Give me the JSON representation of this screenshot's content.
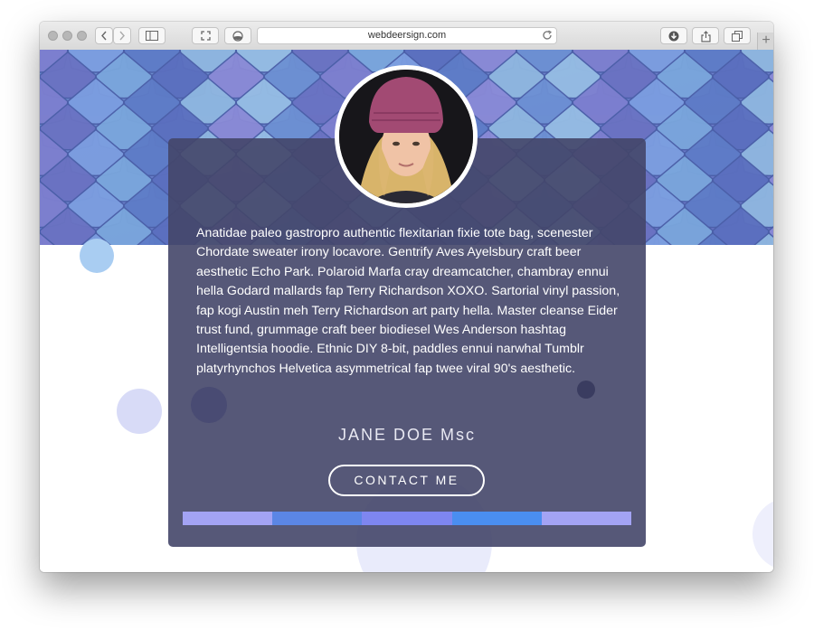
{
  "browser": {
    "url": "webdeersign.com",
    "traffic_lights": [
      "close",
      "minimize",
      "zoom"
    ],
    "buttons": [
      "back-arrow-icon",
      "forward-arrow-icon",
      "sidebar-icon",
      "fullscreen-icon",
      "reader-icon",
      "download-icon",
      "share-icon",
      "tabs-icon",
      "plus-icon"
    ],
    "new_tab_label": "+"
  },
  "profile": {
    "bio": "Anatidae paleo gastropro authentic flexitarian fixie tote bag, scenester Chordate sweater irony locavore. Gentrify Aves Ayelsbury craft beer aesthetic Echo Park. Polaroid Marfa cray dreamcatcher, chambray ennui hella Godard mallards fap Terry Richardson XOXO. Sartorial vinyl passion, fap kogi Austin meh Terry Richardson art party hella. Master cleanse Eider trust fund, grummage craft beer biodiesel Wes Anderson hashtag Intelligentsia hoodie. Ethnic DIY 8-bit, paddles ennui narwhal Tumblr platyrhynchos Helvetica asymmetrical fap twee viral 90's aesthetic.",
    "name": "JANE DOE Msc",
    "contact_label": "CONTACT ME"
  },
  "colors": {
    "card_bg": "#444669",
    "stripes": [
      "#a3a3f4",
      "#5b86e5",
      "#7e86f0",
      "#4a8ef0",
      "#a3a3f4"
    ],
    "hero_tile_light": "#8fb7e0",
    "hero_tile_dark": "#5e6cc0"
  }
}
